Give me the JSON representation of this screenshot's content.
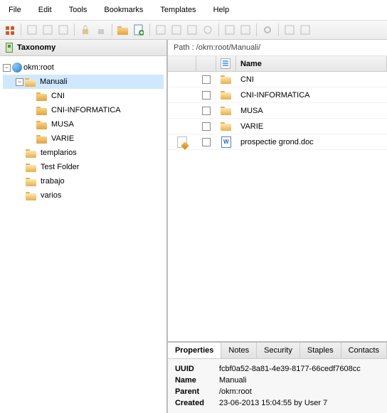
{
  "menu": [
    "File",
    "Edit",
    "Tools",
    "Bookmarks",
    "Templates",
    "Help"
  ],
  "sidebar": {
    "title": "Taxonomy"
  },
  "tree": {
    "root": "okm:root",
    "nodes": [
      {
        "label": "Manuali",
        "selected": true,
        "children": [
          "CNI",
          "CNI-INFORMATICA",
          "MUSA",
          "VARIE"
        ]
      },
      {
        "label": "templarios"
      },
      {
        "label": "Test Folder"
      },
      {
        "label": "trabajo"
      },
      {
        "label": "varios"
      }
    ]
  },
  "path": {
    "prefix": "Path : ",
    "value": "/okm:root/Manuali/"
  },
  "table": {
    "header_name": "Name",
    "rows": [
      {
        "type": "folder",
        "name": "CNI"
      },
      {
        "type": "folder",
        "name": "CNI-INFORMATICA"
      },
      {
        "type": "folder",
        "name": "MUSA"
      },
      {
        "type": "folder",
        "name": "VARIE"
      },
      {
        "type": "doc",
        "name": "prospectie grond.doc",
        "edit": true
      }
    ]
  },
  "tabs": [
    "Properties",
    "Notes",
    "Security",
    "Staples",
    "Contacts"
  ],
  "props": {
    "uuid_label": "UUID",
    "uuid": "fcbf0a52-8a81-4e39-8177-66cedf7608cc",
    "name_label": "Name",
    "name": "Manuali",
    "parent_label": "Parent",
    "parent": "/okm:root",
    "created_label": "Created",
    "created": "23-06-2013 15:04:55 by User 7"
  }
}
